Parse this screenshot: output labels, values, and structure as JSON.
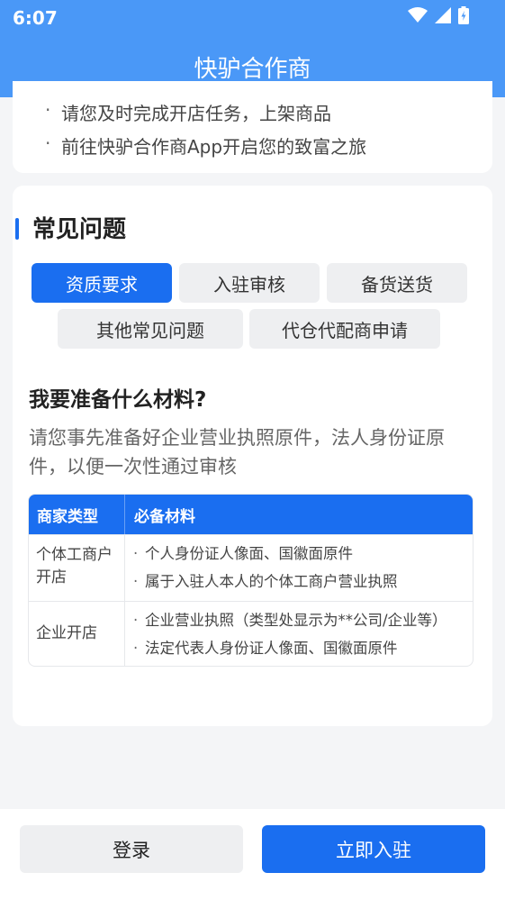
{
  "status_bar": {
    "time": "6:07"
  },
  "header": {
    "title": "快驴合作商"
  },
  "intro": {
    "items": [
      "请您及时完成开店任务，上架商品",
      "前往快驴合作商App开启您的致富之旅"
    ]
  },
  "faq": {
    "title": "常见问题",
    "tabs": [
      "资质要求",
      "入驻审核",
      "备货送货",
      "其他常见问题",
      "代仓代配商申请"
    ],
    "active_tab": "资质要求",
    "question": "我要准备什么材料?",
    "answer": "请您事先准备好企业营业执照原件，法人身份证原件，以便一次性通过审核",
    "table": {
      "headers": [
        "商家类型",
        "必备材料"
      ],
      "rows": [
        {
          "type": "个体工商户开店",
          "materials": [
            "个人身份证人像面、国徽面原件",
            "属于入驻人本人的个体工商户营业执照"
          ]
        },
        {
          "type": "企业开店",
          "materials": [
            "企业营业执照（类型处显示为**公司/企业等）",
            "法定代表人身份证人像面、国徽面原件"
          ]
        }
      ]
    }
  },
  "actions": {
    "login": "登录",
    "join": "立即入驻"
  },
  "colors": {
    "header_bg": "#4a98f7",
    "accent": "#1a6ef0"
  }
}
